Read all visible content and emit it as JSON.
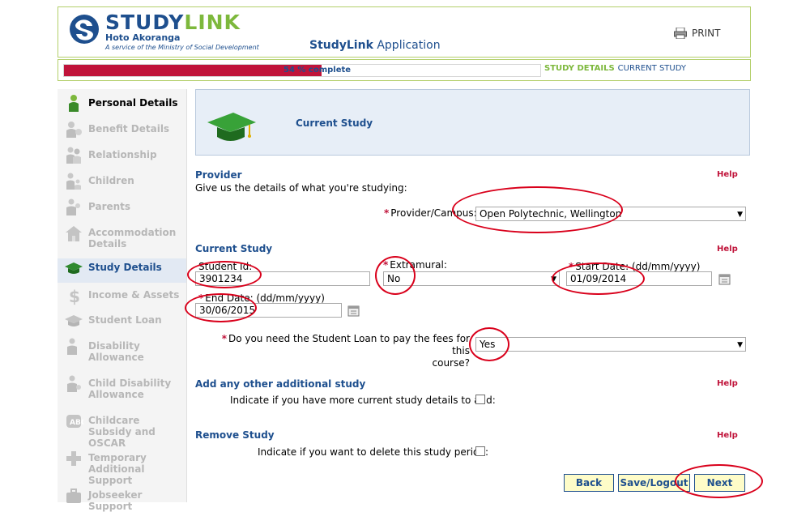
{
  "header": {
    "logo_word_a": "STUDY",
    "logo_word_b": "LINK",
    "logo_sub": "Hoto Akoranga",
    "logo_tag": "A service of the Ministry of Social Development",
    "app_title_bold": "StudyLink",
    "app_title_rest": " Application",
    "print_label": "PRINT"
  },
  "progress": {
    "percent": 54,
    "text": "54 % complete",
    "crumb_section": "STUDY DETAILS",
    "crumb_page": "CURRENT STUDY"
  },
  "sidebar": {
    "items": [
      {
        "label": "Personal Details",
        "icon": "person-icon",
        "state": "done"
      },
      {
        "label": "Benefit Details",
        "icon": "benefit-icon",
        "state": "todo"
      },
      {
        "label": "Relationship",
        "icon": "relationship-icon",
        "state": "todo"
      },
      {
        "label": "Children",
        "icon": "children-icon",
        "state": "todo"
      },
      {
        "label": "Parents",
        "icon": "parents-icon",
        "state": "todo"
      },
      {
        "label": "Accommodation Details",
        "icon": "house-icon",
        "state": "todo"
      },
      {
        "label": "Study Details",
        "icon": "graduation-cap-icon",
        "state": "current"
      },
      {
        "label": "Income & Assets",
        "icon": "dollar-icon",
        "state": "todo"
      },
      {
        "label": "Student Loan",
        "icon": "graduation-cap-icon",
        "state": "todo"
      },
      {
        "label": "Disability Allowance",
        "icon": "disability-icon",
        "state": "todo"
      },
      {
        "label": "Child Disability Allowance",
        "icon": "child-disability-icon",
        "state": "todo"
      },
      {
        "label": "Childcare Subsidy and OSCAR",
        "icon": "blocks-icon",
        "state": "todo"
      },
      {
        "label": "Temporary Additional Support",
        "icon": "plus-icon",
        "state": "todo"
      },
      {
        "label": "Jobseeker Support",
        "icon": "briefcase-icon",
        "state": "todo"
      }
    ]
  },
  "main": {
    "panel_title": "Current Study",
    "provider": {
      "title": "Provider",
      "help": "Help",
      "intro": "Give us the details of what you're studying:",
      "campus_label": "Provider/Campus:",
      "campus_value": "Open Polytechnic, Wellington"
    },
    "current_study": {
      "title": "Current Study",
      "help": "Help",
      "student_id_label": "Student Id:",
      "student_id_value": "3901234",
      "extramural_label": "Extramural:",
      "extramural_value": "No",
      "start_date_label": "Start Date: (dd/mm/yyyy)",
      "start_date_value": "01/09/2014",
      "end_date_label": "End Date: (dd/mm/yyyy)",
      "end_date_value": "30/06/2015",
      "loan_q_line1": "Do you need the Student Loan to pay the fees for this",
      "loan_q_line2": "course?",
      "loan_value": "Yes"
    },
    "additional": {
      "title": "Add any other additional study",
      "help": "Help",
      "label": "Indicate if you have more current study details to add:"
    },
    "remove": {
      "title": "Remove Study",
      "help": "Help",
      "label": "Indicate if you want to delete this study period:"
    },
    "buttons": {
      "back": "Back",
      "save": "Save/Logout",
      "next": "Next"
    }
  },
  "colors": {
    "brand_blue": "#1e4f8e",
    "brand_green": "#7db83c",
    "progress_red": "#c0133a",
    "annotation_red": "#d9001b"
  }
}
